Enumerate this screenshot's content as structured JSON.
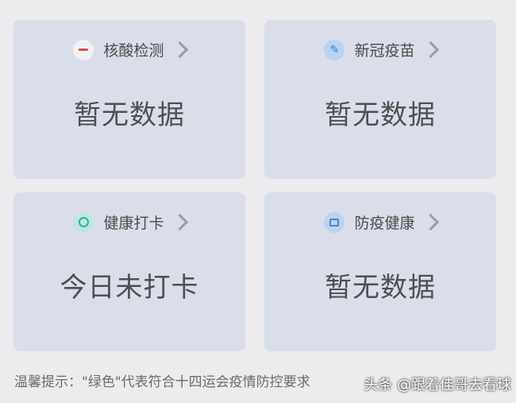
{
  "cards": [
    {
      "title": "核酸检测",
      "icon": "minus-icon",
      "value": "暂无数据"
    },
    {
      "title": "新冠疫苗",
      "icon": "syringe-icon",
      "value": "暂无数据"
    },
    {
      "title": "健康打卡",
      "icon": "health-check-icon",
      "value": "今日未打卡"
    },
    {
      "title": "防疫健康",
      "icon": "medical-kit-icon",
      "value": "暂无数据"
    }
  ],
  "tip": "温馨提示：\"绿色\"代表符合十四运会疫情防控要求",
  "watermark": "头条 @跟着佳哥去看球"
}
